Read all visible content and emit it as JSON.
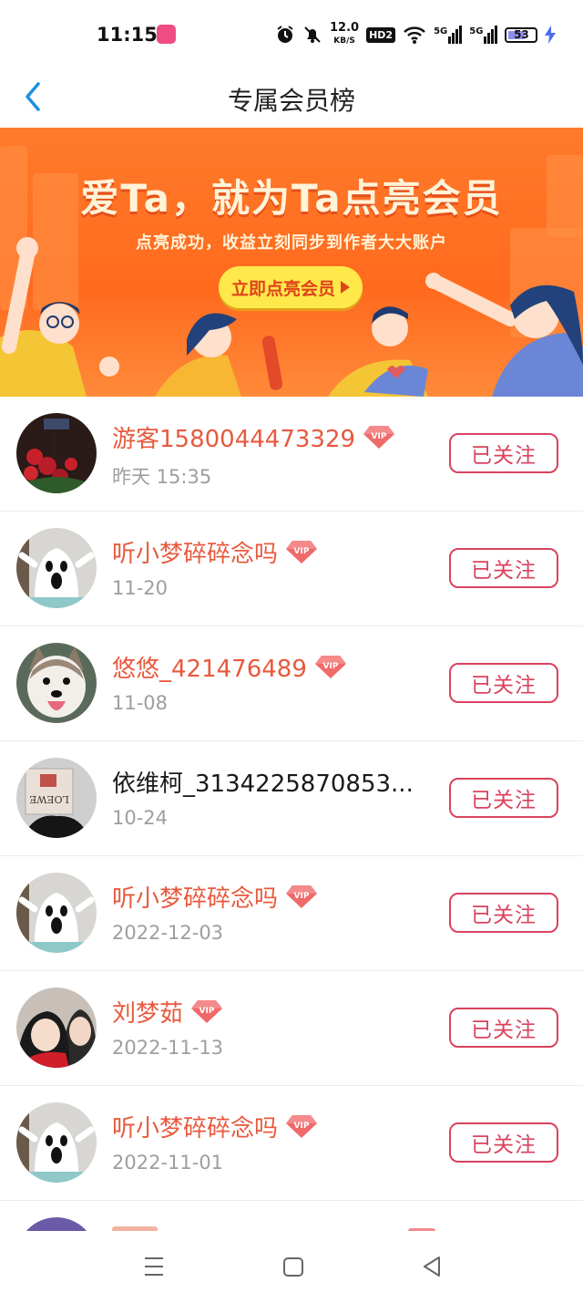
{
  "status_bar": {
    "time": "11:15",
    "network_speed": "12.0",
    "network_unit": "KB/S",
    "hd_label": "HD2",
    "signal1": "5G",
    "signal2": "5G",
    "battery": "53"
  },
  "header": {
    "title": "专属会员榜",
    "back_icon": "chevron-left-icon"
  },
  "banner": {
    "headline": "爱Ta，就为Ta点亮会员",
    "subtitle": "点亮成功，收益立刻同步到作者大大账户",
    "cta_label": "立即点亮会员"
  },
  "members": [
    {
      "name": "游客1580044473329",
      "date": "昨天 15:35",
      "vip": true,
      "follow_label": "已关注",
      "avatar": "roses"
    },
    {
      "name": "听小梦碎碎念吗",
      "date": "11-20",
      "vip": true,
      "follow_label": "已关注",
      "avatar": "ghost"
    },
    {
      "name": "悠悠_421476489",
      "date": "11-08",
      "vip": true,
      "follow_label": "已关注",
      "avatar": "dog"
    },
    {
      "name": "依维柯_3134225870853...",
      "date": "10-24",
      "vip": false,
      "follow_label": "已关注",
      "avatar": "box"
    },
    {
      "name": "听小梦碎碎念吗",
      "date": "2022-12-03",
      "vip": true,
      "follow_label": "已关注",
      "avatar": "ghost"
    },
    {
      "name": "刘梦茹",
      "date": "2022-11-13",
      "vip": true,
      "follow_label": "已关注",
      "avatar": "people"
    },
    {
      "name": "听小梦碎碎念吗",
      "date": "2022-11-01",
      "vip": true,
      "follow_label": "已关注",
      "avatar": "ghost"
    }
  ],
  "colors": {
    "accent": "#e8593d",
    "follow_border": "#d9435e",
    "banner_bg": "#ff6a1e",
    "back_blue": "#1e90e0"
  },
  "nav_bar": {
    "menu_icon": "menu-icon",
    "home_icon": "home-square-icon",
    "back_icon": "back-triangle-icon"
  }
}
